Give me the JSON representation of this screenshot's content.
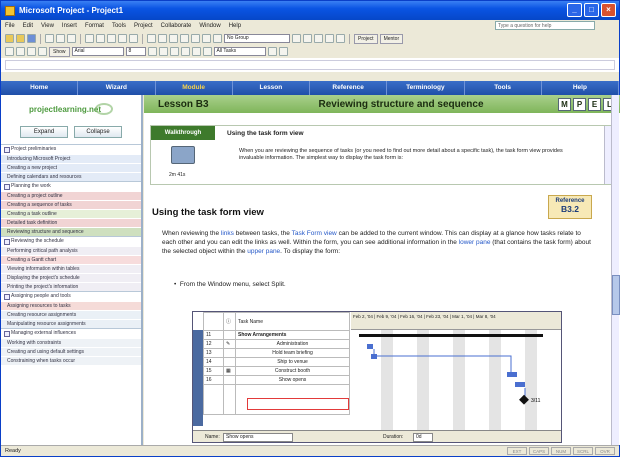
{
  "app": {
    "title": "Microsoft Project - Project1"
  },
  "menu": [
    "File",
    "Edit",
    "View",
    "Insert",
    "Format",
    "Tools",
    "Project",
    "Collaborate",
    "Window",
    "Help"
  ],
  "help_placeholder": "Type a question for help",
  "toolbar": {
    "group_combo": "No Group",
    "show_label": "Show",
    "font_combo": "Arial",
    "size_combo": "8",
    "filter_combo": "All Tasks",
    "project_btn": "Project",
    "mentor_btn": "Mentor"
  },
  "nav": [
    {
      "label": "Home"
    },
    {
      "label": "Wizard"
    },
    {
      "label": "Module"
    },
    {
      "label": "Lesson"
    },
    {
      "label": "Reference"
    },
    {
      "label": "Terminology"
    },
    {
      "label": "Tools"
    },
    {
      "label": "Help"
    }
  ],
  "sidebar": {
    "logo": "projectlearning.net",
    "expand": "Expand",
    "collapse": "Collapse",
    "groups": [
      {
        "head": "Project preliminaries",
        "items": [
          "Introducing Microsoft Project",
          "Creating a new project",
          "Defining calendars and resources"
        ]
      },
      {
        "head": "Planning the work",
        "items": [
          "Creating a project outline",
          "Creating a sequence of tasks",
          "Creating a task outline",
          "Detailed task definition",
          "Reviewing structure and sequence"
        ]
      },
      {
        "head": "Reviewing the schedule",
        "items": [
          "Performing critical path analysis",
          "Creating a Gantt chart",
          "Viewing information within tables",
          "Displaying the project's schedule",
          "Printing the project's information"
        ]
      },
      {
        "head": "Assigning people and tools",
        "items": [
          "Assigning resources to tasks",
          "Creating resource assignments",
          "Manipulating resource assignments"
        ]
      },
      {
        "head": "Managing external influences",
        "items": [
          "Working with constraints",
          "Creating and using default settings",
          "Constraining when tasks occur"
        ]
      }
    ]
  },
  "lesson": {
    "number": "Lesson B3",
    "title": "Reviewing structure and sequence",
    "mpel": [
      "M",
      "P",
      "E",
      "L"
    ]
  },
  "walkthrough": {
    "tab": "Walkthrough",
    "title": "Using the task form view",
    "duration": "2m 41s",
    "desc": "When you are reviewing the sequence of tasks (or you need to find out more detail about a specific task), the task form view provides invaluable information. The simplest way to display the task form is:"
  },
  "section": {
    "heading": "Using the task form view",
    "reference_label": "Reference",
    "reference_code": "B3.2"
  },
  "body": {
    "p1a": "When reviewing the ",
    "p1link1": "links",
    "p1b": " between tasks, the ",
    "p1link2": "Task Form view",
    "p1c": " can be added to the current window.  This can display at a glance how tasks relate to each other and you can edit the links as well.  Within the form, you can see additional information in the ",
    "p1link3": "lower pane",
    "p1d": " (that contains the task form) about the selected object within the ",
    "p1link4": "upper pane",
    "p1e": ".  To display the form:",
    "bullet": "From the Window menu, select Split."
  },
  "screenshot": {
    "col_header": "Task Name",
    "rows": [
      {
        "id": "11",
        "name": "Show Arrangements"
      },
      {
        "id": "12",
        "name": "Administration"
      },
      {
        "id": "13",
        "name": "Hold team briefing"
      },
      {
        "id": "14",
        "name": "Ship to venue"
      },
      {
        "id": "15",
        "name": "Construct booth"
      },
      {
        "id": "16",
        "name": "Show opens"
      }
    ],
    "dates": "Feb 2, '04 | Feb 9, '04 | Feb 16, '04 | Feb 23, '04 | Mar 1, '04 | Mar 8, '04",
    "side_label": "Gantt Chart",
    "milestone": "3/11",
    "form_name_label": "Name:",
    "form_name": "Show opens",
    "form_duration_label": "Duration:",
    "form_duration": "0d"
  },
  "status": {
    "text": "Ready",
    "cells": [
      "EXT",
      "CAPS",
      "NUM",
      "SCRL",
      "OVR"
    ]
  }
}
